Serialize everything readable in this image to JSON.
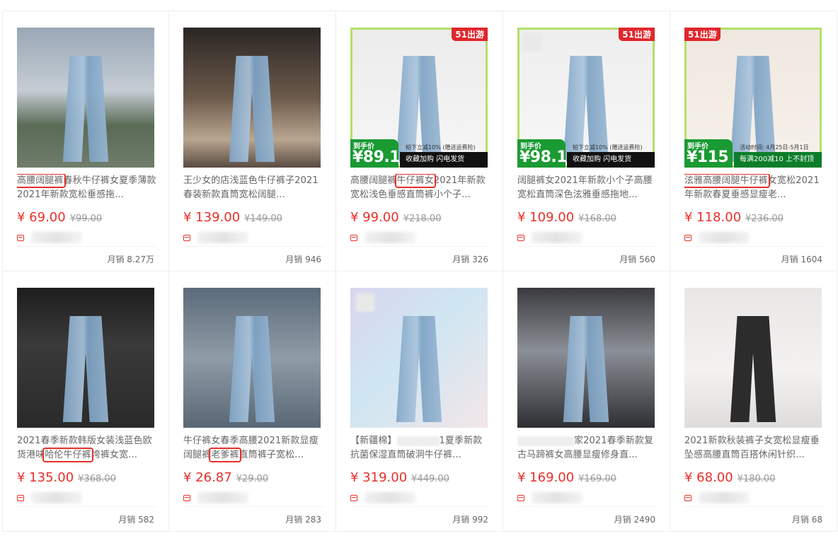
{
  "products": [
    {
      "title_pre": "",
      "title_hl": "高腰阔腿裤",
      "title_post": "春秋牛仔裤女夏季薄款2021年新款宽松垂感拖...",
      "price": "¥ 69.00",
      "old": "¥99.00",
      "sales": "月销 8.27万",
      "promo": null
    },
    {
      "title_pre": "王少女的店浅蓝色牛仔裤子2021春装新款直筒宽松阔腿...",
      "title_hl": "",
      "title_post": "",
      "price": "¥ 139.00",
      "old": "¥149.00",
      "sales": "月销 946",
      "promo": null
    },
    {
      "title_pre": "高腰阔腿裤",
      "title_hl": "牛仔裤女",
      "title_post": "2021年新款宽松浅色垂感直筒裤小个子...",
      "price": "¥ 99.00",
      "old": "¥218.00",
      "sales": "月销 326",
      "promo": {
        "tag": "51出游",
        "label": "到手价",
        "value": "¥89.1",
        "bar": "收藏加购  闪电发货",
        "note": "拍下立减10% (赠送运费险)"
      }
    },
    {
      "title_pre": "阔腿裤女2021年新款小个子高腰宽松直筒深色泫雅垂感拖地...",
      "title_hl": "",
      "title_post": "",
      "price": "¥ 109.00",
      "old": "¥168.00",
      "sales": "月销 560",
      "promo": {
        "tag": "51出游",
        "label": "到手价",
        "value": "¥98.1",
        "bar": "收藏加购  闪电发货",
        "note": "拍下立减10% (赠送运费险)"
      }
    },
    {
      "title_pre": "",
      "title_hl": "泫雅高腰阔腿牛仔裤",
      "title_post": "女宽松2021年新款春夏垂感显瘦老...",
      "price": "¥ 118.00",
      "old": "¥236.00",
      "sales": "月销 1604",
      "promo": {
        "tag": "51出游",
        "label": "到手价",
        "value": "¥115",
        "bar": "每满200减10 上不封顶",
        "note": "活动时间: 4月25日-5月1日"
      }
    },
    {
      "title_pre": "2021春季新款韩版女装浅蓝色欧货港味",
      "title_hl": "哈伦牛仔裤",
      "title_post": "垮裤女宽...",
      "price": "¥ 135.00",
      "old": "¥368.00",
      "sales": "月销 582",
      "promo": null
    },
    {
      "title_pre": "牛仔裤女春季高腰2021新款显瘦阔腿裤",
      "title_hl": "老爹裤",
      "title_post": "直筒裤子宽松...",
      "price": "¥ 26.87",
      "old": "¥29.00",
      "sales": "月销 283",
      "promo": null
    },
    {
      "title_pre": "【新疆棉】",
      "title_hl": "",
      "title_post": "1夏季新款抗菌保湿直筒破洞牛仔裤...",
      "price": "¥ 319.00",
      "old": "¥449.00",
      "sales": "月销 992",
      "promo": null
    },
    {
      "title_pre": "家2021春季新款复古马蹄裤女高腰显瘦修身直...",
      "title_hl": "",
      "title_post": "",
      "price": "¥ 169.00",
      "old": "¥169.00",
      "sales": "月销 2490",
      "promo": null
    },
    {
      "title_pre": "2021新款秋装裤子女宽松显瘦垂坠感高腰直筒百搭休闲针织...",
      "title_hl": "",
      "title_post": "",
      "price": "¥ 68.00",
      "old": "¥180.00",
      "sales": "月销 68",
      "promo": null
    }
  ],
  "colors": {
    "accent": "#e8302a",
    "promo_green": "#1a9a32"
  }
}
